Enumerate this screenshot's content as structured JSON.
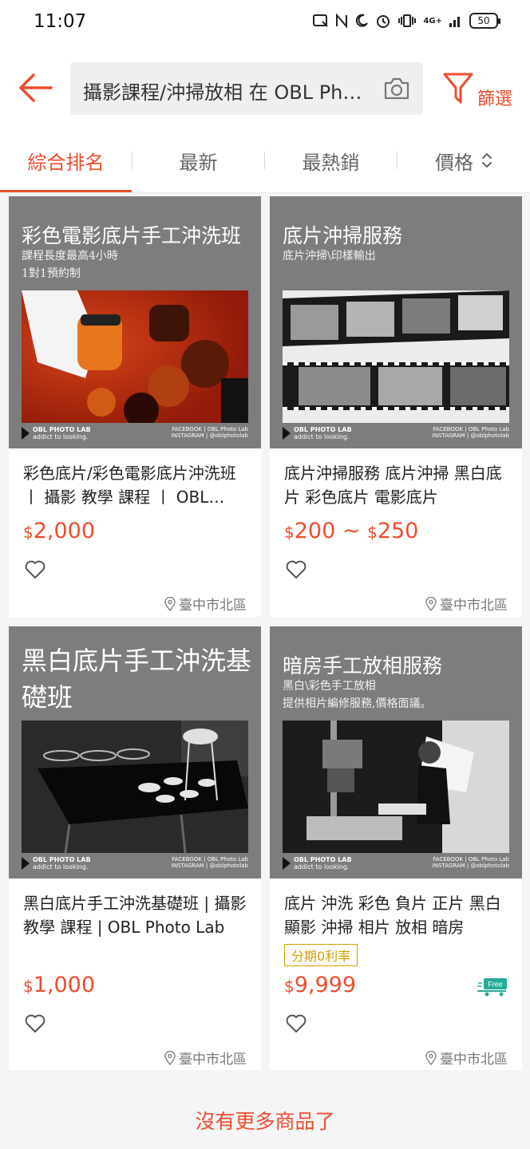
{
  "status_bar": {
    "time": "11:07",
    "battery": "50",
    "network": "4G+"
  },
  "header": {
    "search_text": "攝影課程/沖掃放相 在 OBL Photo Lab",
    "filter_label": "篩選"
  },
  "sort_tabs": [
    {
      "label": "綜合排名",
      "active": true
    },
    {
      "label": "最新",
      "active": false
    },
    {
      "label": "最熱銷",
      "active": false
    },
    {
      "label": "價格",
      "active": false
    }
  ],
  "products": [
    {
      "img_title": "彩色電影底片手工沖洗班",
      "img_sub": [
        "課程長度最高4小時",
        "1對1預約制"
      ],
      "brand": [
        "OBL PHOTO LAB",
        "addict to looking."
      ],
      "social": [
        "FACEBOOK | OBL Photo Lab",
        "INSTAGRAM | @oblphotolab"
      ],
      "title": "彩色底片/彩色電影底片沖洗班丨 攝影 教學 課程 丨 OBL Photo Lab",
      "currency": "$",
      "price": "2,000",
      "location": "臺中市北區"
    },
    {
      "img_title": "底片沖掃服務",
      "img_sub": [
        "底片沖掃\\印樣輸出"
      ],
      "brand": [
        "OBL PHOTO LAB",
        "addict to looking."
      ],
      "social": [
        "FACEBOOK | OBL Photo Lab",
        "INSTAGRAM | @oblphotolab"
      ],
      "title": "底片沖掃服務 底片沖掃 黑白底片 彩色底片 電影底片",
      "currency": "$",
      "price": "200",
      "price_sep": "~",
      "price_max": "250",
      "location": "臺中市北區"
    },
    {
      "img_title": "黑白底片手工沖洗基礎班",
      "img_sub": [],
      "brand": [
        "OBL PHOTO LAB",
        "addict to looking."
      ],
      "social": [
        "FACEBOOK | OBL Photo Lab",
        "INSTAGRAM | @oblphotolab"
      ],
      "title": "黑白底片手工沖洗基礎班 | 攝影 教學 課程 | OBL Photo Lab",
      "currency": "$",
      "price": "1,000",
      "location": "臺中市北區"
    },
    {
      "img_title": "暗房手工放相服務",
      "img_sub": [
        "黑白\\彩色手工放相",
        "提供相片編修服務,價格面議。"
      ],
      "brand": [
        "OBL PHOTO LAB",
        "addict to looking."
      ],
      "social": [
        "FACEBOOK | OBL Photo Lab",
        "INSTAGRAM | @oblphotolab"
      ],
      "title": "底片 沖洗 彩色 負片 正片 黑白 顯影 沖掃 相片 放相 暗房",
      "promo": "分期0利率",
      "free_ship": "Free",
      "currency": "$",
      "price": "9,999",
      "location": "臺中市北區"
    }
  ],
  "footer": {
    "no_more": "沒有更多商品了"
  },
  "colors": {
    "accent": "#ee4d2d",
    "promo": "#d0a000",
    "free_ship": "#26aa99",
    "background": "#f5f5f5",
    "image_bg": "#7d7d7d"
  },
  "icons": [
    "back-arrow-icon",
    "camera-icon",
    "filter-funnel-icon",
    "sort-updown-icon",
    "heart-icon",
    "location-pin-icon",
    "free-shipping-truck-icon"
  ]
}
